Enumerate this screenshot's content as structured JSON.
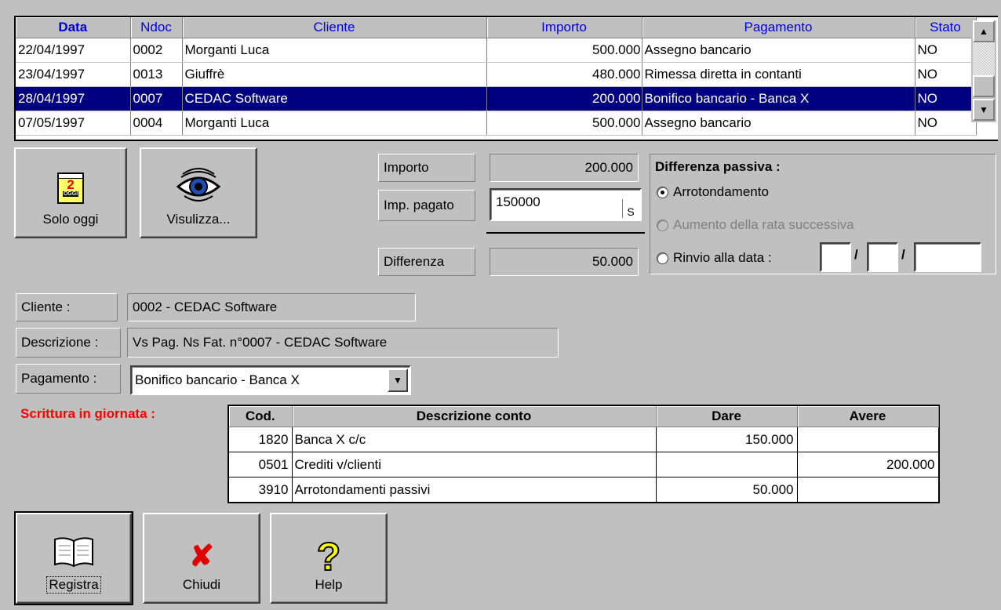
{
  "grid": {
    "headers": [
      "Data",
      "Ndoc",
      "Cliente",
      "Importo",
      "Pagamento",
      "Stato"
    ],
    "rows": [
      {
        "data": "22/04/1997",
        "ndoc": "0002",
        "cliente": "Morganti Luca",
        "importo": "500.000",
        "pagamento": "Assegno bancario",
        "stato": "NO"
      },
      {
        "data": "23/04/1997",
        "ndoc": "0013",
        "cliente": "Giuffrè",
        "importo": "480.000",
        "pagamento": "Rimessa diretta in contanti",
        "stato": "NO"
      },
      {
        "data": "28/04/1997",
        "ndoc": "0007",
        "cliente": "CEDAC Software",
        "importo": "200.000",
        "pagamento": "Bonifico bancario - Banca X",
        "stato": "NO"
      },
      {
        "data": "07/05/1997",
        "ndoc": "0004",
        "cliente": "Morganti Luca",
        "importo": "500.000",
        "pagamento": "Assegno bancario",
        "stato": "NO"
      }
    ]
  },
  "buttons": {
    "solo_oggi": "Solo oggi",
    "calendar_num": "2",
    "calendar_text": "OGGI",
    "visualizza": "Visulizza...",
    "registra": "Registra",
    "chiudi": "Chiudi",
    "help": "Help"
  },
  "payment": {
    "importo_label": "Importo",
    "importo_value": "200.000",
    "pagato_label": "Imp. pagato",
    "pagato_value": "150000",
    "pagato_btn": "S",
    "differenza_label": "Differenza",
    "differenza_value": "50.000"
  },
  "diff": {
    "title": "Differenza passiva :",
    "opt1": "Arrotondamento",
    "opt2": "Aumento della rata successiva",
    "opt3": "Rinvio alla data :",
    "sep": "/"
  },
  "details": {
    "cliente_label": "Cliente :",
    "cliente_value": "0002 - CEDAC Software",
    "descr_label": "Descrizione :",
    "descr_value": "Vs Pag. Ns Fat. n°0007 - CEDAC Software",
    "pag_label": "Pagamento :",
    "pag_value": "Bonifico bancario - Banca X"
  },
  "scrittura": {
    "title": "Scrittura in giornata :",
    "title_color": "#ff0000",
    "headers": [
      "Cod.",
      "Descrizione conto",
      "Dare",
      "Avere"
    ],
    "rows": [
      {
        "cod": "1820",
        "descr": "Banca X c/c",
        "dare": "150.000",
        "avere": ""
      },
      {
        "cod": "0501",
        "descr": "Crediti v/clienti",
        "dare": "",
        "avere": "200.000"
      },
      {
        "cod": "3910",
        "descr": "Arrotondamenti passivi",
        "dare": "50.000",
        "avere": ""
      }
    ]
  }
}
